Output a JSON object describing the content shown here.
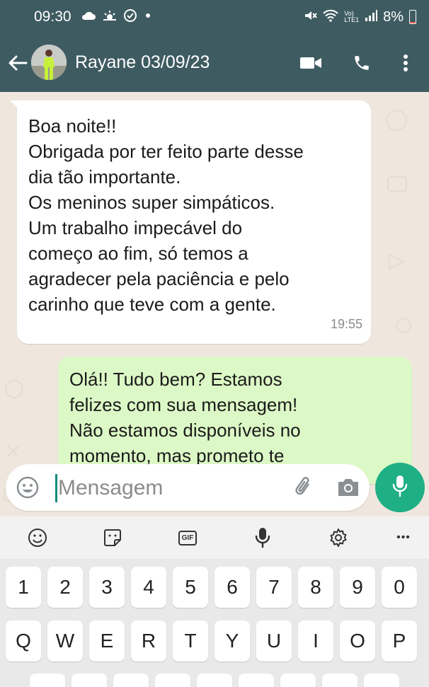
{
  "status_bar": {
    "time": "09:30",
    "battery": "8%",
    "left_icons": [
      "cloud-icon",
      "sunrise-icon",
      "check-circle-icon",
      "dot-icon"
    ],
    "right_icons": [
      "mute-icon",
      "wifi-icon",
      "volte-icon",
      "signal-icon"
    ],
    "volte_text": "Vo)",
    "lte_text": "LTE1",
    "battery_level": 0.08
  },
  "header": {
    "contact_name": "Rayane 03/09/23",
    "icons": [
      "back-arrow-icon",
      "avatar",
      "video-call-icon",
      "phone-icon",
      "more-vertical-icon"
    ]
  },
  "messages": [
    {
      "direction": "incoming",
      "lines": [
        "Boa noite!!",
        "Obrigada por ter feito parte desse",
        "dia tão importante.",
        "Os meninos super simpáticos.",
        "Um trabalho impecável do",
        "começo ao fim, só temos a",
        "agradecer pela paciência e pelo",
        "carinho que teve com a gente."
      ],
      "time": "19:55"
    },
    {
      "direction": "outgoing",
      "lines": [
        "Olá!! Tudo bem? Estamos",
        "felizes com sua mensagem!",
        "Não estamos disponíveis no",
        "momento, mas prometo te"
      ]
    }
  ],
  "composer": {
    "placeholder": "Mensagem",
    "icons": [
      "emoji-icon",
      "attach-icon",
      "camera-icon",
      "mic-icon"
    ]
  },
  "keyboard_toolbar": {
    "gif_label": "GIF",
    "icons": [
      "smiley-icon",
      "sticker-icon",
      "gif-icon",
      "mic-icon",
      "settings-icon",
      "more-horizontal-icon"
    ],
    "more_label": "•••"
  },
  "keyboard": {
    "number_row": [
      "1",
      "2",
      "3",
      "4",
      "5",
      "6",
      "7",
      "8",
      "9",
      "0"
    ],
    "letter_row": [
      "Q",
      "W",
      "E",
      "R",
      "T",
      "Y",
      "U",
      "I",
      "O",
      "P"
    ]
  },
  "colors": {
    "header": "#3f5b62",
    "chat_bg": "#efe7de",
    "incoming_bubble": "#ffffff",
    "outgoing_bubble": "#dcf8c6",
    "accent": "#1faf85"
  }
}
